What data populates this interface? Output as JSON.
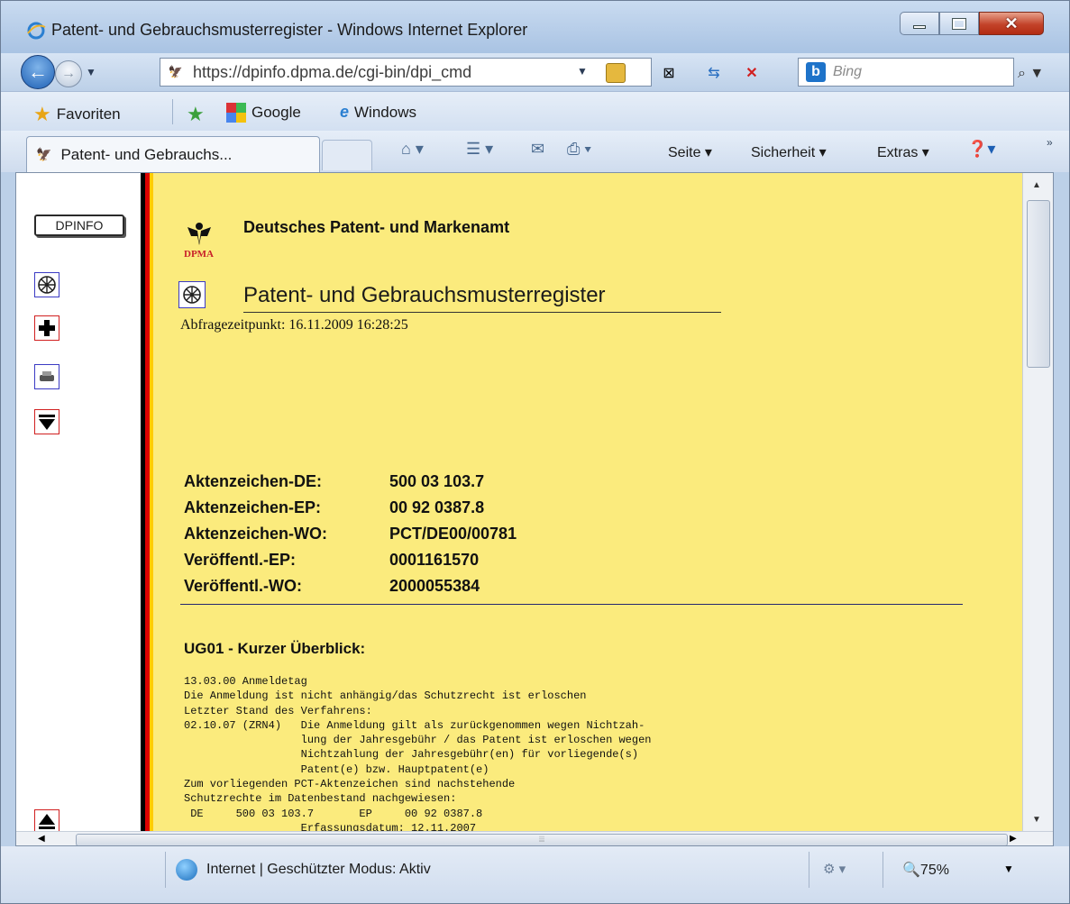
{
  "window": {
    "title": "Patent- und Gebrauchsmusterregister - Windows Internet Explorer"
  },
  "address_bar": {
    "url": "https://dpinfo.dpma.de/cgi-bin/dpi_cmd",
    "search_placeholder": "Bing"
  },
  "favorites_bar": {
    "favorites_label": "Favoriten",
    "links": [
      "Google",
      "Windows"
    ]
  },
  "tab": {
    "label": "Patent- und Gebrauchs..."
  },
  "command_bar": {
    "page_label": "Seite",
    "security_label": "Sicherheit",
    "extras_label": "Extras"
  },
  "left_frame": {
    "dpinfo_label": "DPINFO"
  },
  "page": {
    "office_name": "Deutsches Patent- und Markenamt",
    "logo_text": "DPMA",
    "register_title": "Patent- und Gebrauchsmusterregister",
    "query_time": "Abfragezeitpunkt: 16.11.2009 16:28:25",
    "file_numbers": [
      {
        "label": "Aktenzeichen-DE:",
        "value": "500 03 103.7"
      },
      {
        "label": "Aktenzeichen-EP:",
        "value": "00 92 0387.8"
      },
      {
        "label": "Aktenzeichen-WO:",
        "value": "PCT/DE00/00781"
      },
      {
        "label": "Veröffentl.-EP:",
        "value": "0001161570"
      },
      {
        "label": "Veröffentl.-WO:",
        "value": "2000055384"
      }
    ],
    "section_title": "UG01 - Kurzer Überblick:",
    "section_lines": [
      "13.03.00 Anmeldetag",
      "Die Anmeldung ist nicht anhängig/das Schutzrecht ist erloschen",
      "Letzter Stand des Verfahrens:",
      "02.10.07 (ZRN4)   Die Anmeldung gilt als zurückgenommen wegen Nichtzah-",
      "                  lung der Jahresgebühr / das Patent ist erloschen wegen",
      "                  Nichtzahlung der Jahresgebühr(en) für vorliegende(s)",
      "                  Patent(e) bzw. Hauptpatent(e)",
      "Zum vorliegenden PCT-Aktenzeichen sind nachstehende",
      "Schutzrechte im Datenbestand nachgewiesen:",
      " DE     500 03 103.7       EP     00 92 0387.8",
      "                  Erfassungsdatum: 12.11.2007"
    ]
  },
  "status_bar": {
    "zone_text": "Internet | Geschützter Modus: Aktiv",
    "zoom": "75%"
  },
  "colors": {
    "page_background": "#fbeb7d",
    "flag_black": "#000000",
    "flag_red": "#dd0000",
    "flag_gold": "#ffcc00"
  }
}
